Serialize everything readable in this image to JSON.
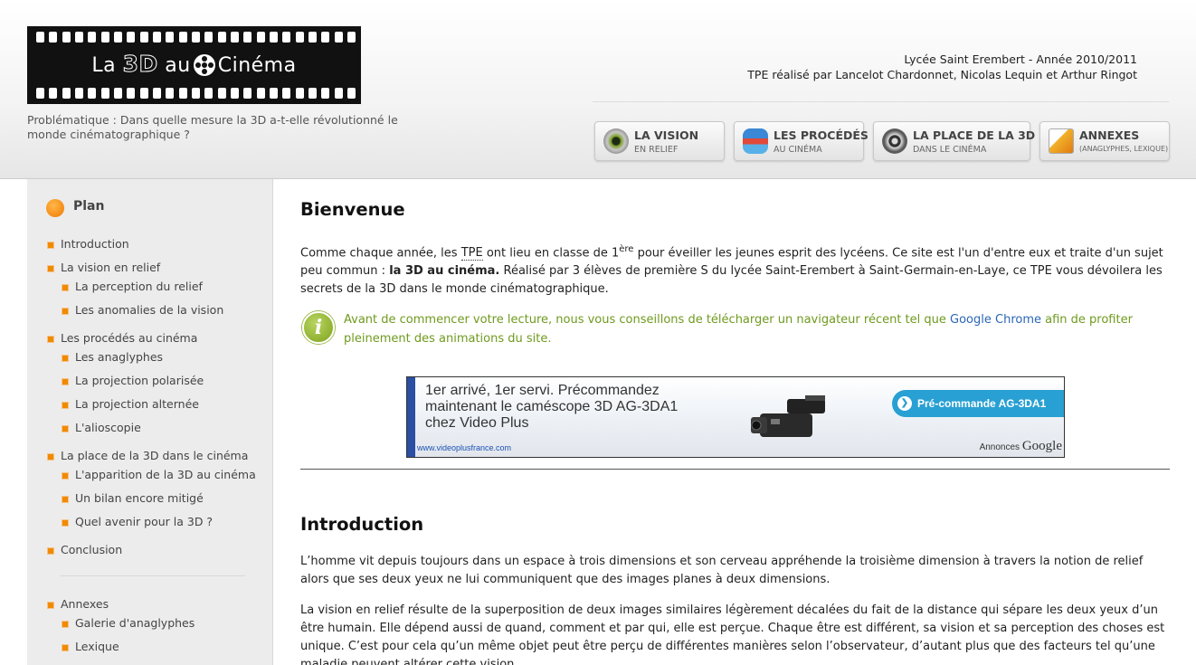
{
  "header": {
    "logo_text_before": "La",
    "logo_text_3d": "3D",
    "logo_text_mid": "au",
    "logo_text_after": "Cinéma",
    "school_line1": "Lycée Saint Erembert - Année 2010/2011",
    "school_line2": "TPE réalisé par Lancelot Chardonnet, Nicolas Lequin et Arthur Ringot",
    "problem": "Problématique : Dans quelle mesure la 3D a-t-elle révolutionné le monde cinématographique ?"
  },
  "nav": [
    {
      "title": "LA VISION",
      "subtitle": "EN RELIEF",
      "icon": "eye-icon"
    },
    {
      "title": "LES PROCÉDÉS",
      "subtitle": "AU CINÉMA",
      "icon": "3d-glasses-icon"
    },
    {
      "title": "LA PLACE DE LA 3D",
      "subtitle": "DANS LE CINÉMA",
      "icon": "film-reel-icon"
    },
    {
      "title": "ANNEXES",
      "subtitle": "(ANAGLYPHES, LEXIQUE)",
      "icon": "documents-icon"
    }
  ],
  "sidebar": {
    "title": "Plan",
    "items": [
      "Introduction",
      "La vision en relief",
      "La perception du relief",
      "Les anomalies de la vision",
      "Les procédés au cinéma",
      "Les anaglyphes",
      "La projection polarisée",
      "La projection alternée",
      "L'alioscopie",
      "La place de la 3D dans le cinéma",
      "L'apparition de la 3D au cinéma",
      "Un bilan encore mitigé",
      "Quel avenir pour la 3D ?",
      "Conclusion",
      "Annexes",
      "Galerie d'anaglyphes",
      "Lexique"
    ]
  },
  "content": {
    "welcome_title": "Bienvenue",
    "welcome_p_1": "Comme chaque année, les ",
    "welcome_tpe": "TPE",
    "welcome_p_2": " ont lieu en classe de 1",
    "welcome_sup": "ère",
    "welcome_p_3": " pour éveiller les jeunes esprit des lycéens. Ce site est l'un d'entre eux et traite d'un sujet peu commun : ",
    "welcome_bold": "la 3D au cinéma.",
    "welcome_p_4": " Réalisé par 3 élèves de première S du lycée Saint-Erembert à Saint-Germain-en-Laye, ce TPE vous dévoilera les secrets de la 3D dans le monde cinématographique.",
    "info_1": "Avant de commencer votre lecture, nous vous conseillons de télécharger un navigateur récent tel que ",
    "info_link": "Google Chrome",
    "info_2": " afin de profiter pleinement des animations du site.",
    "info_icon_glyph": "i",
    "ad": {
      "line1": "1er arrivé, 1er servi. Précommandez",
      "line2": "maintenant le caméscope 3D AG-3DA1",
      "line3": "chez Video Plus",
      "url": "www.videoplusfrance.com",
      "button": "Pré-commande AG-3DA1",
      "button_glyph": "❯",
      "annonces": "Annonces",
      "google": "Google"
    },
    "intro_title": "Introduction",
    "intro_p1": "L’homme vit depuis toujours dans un espace à trois dimensions et son cerveau appréhende la troisième dimension à travers la notion de relief alors que ses deux yeux ne lui communiquent que des images planes à deux dimensions.",
    "intro_p2": "La vision en relief résulte de la superposition de deux images similaires légèrement décalées du fait de la distance qui sépare les deux yeux d’un être humain. Elle dépend aussi de quand, comment et par qui, elle est perçue. Chaque être est différent, sa vision et sa perception des choses est unique. C’est pour cela qu’un même objet peut être perçu de différentes manières selon l’observateur, d’autant plus que des facteurs tel qu’une maladie peuvent altérer cette vision."
  }
}
